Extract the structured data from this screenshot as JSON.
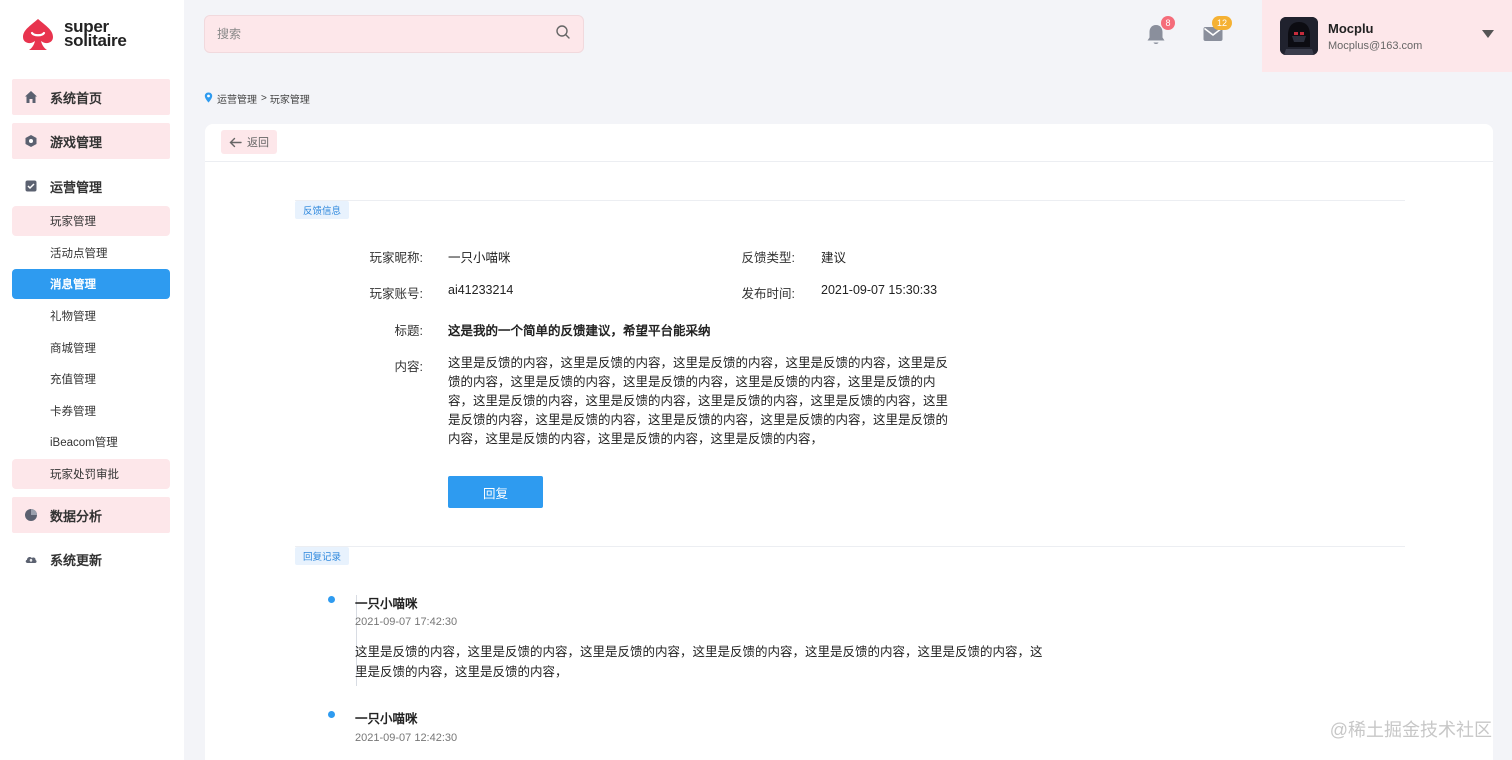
{
  "brand": {
    "line1": "super",
    "line2": "solitaire",
    "color": "#e8344e"
  },
  "sidebar": {
    "items": [
      {
        "label": "系统首页",
        "icon": "home-icon"
      },
      {
        "label": "游戏管理",
        "icon": "game-icon"
      },
      {
        "label": "运营管理",
        "icon": "operations-icon"
      },
      {
        "label": "数据分析",
        "icon": "pie-chart-icon"
      },
      {
        "label": "系统更新",
        "icon": "cloud-upload-icon"
      }
    ],
    "sub_items": [
      {
        "label": "玩家管理"
      },
      {
        "label": "活动点管理"
      },
      {
        "label": "消息管理"
      },
      {
        "label": "礼物管理"
      },
      {
        "label": "商城管理"
      },
      {
        "label": "充值管理"
      },
      {
        "label": "卡券管理"
      },
      {
        "label": "iBeacom管理"
      },
      {
        "label": "玩家处罚审批"
      }
    ],
    "active": "消息管理"
  },
  "search": {
    "placeholder": "搜索",
    "value": ""
  },
  "header": {
    "notifications": {
      "count": "8"
    },
    "messages": {
      "count": "12"
    },
    "user": {
      "name": "Mocplu",
      "email": "Mocplus@163.com"
    }
  },
  "breadcrumb": {
    "items": [
      "运营管理",
      "玩家管理"
    ],
    "separator": ">"
  },
  "card": {
    "back_label": "返回",
    "feedback_section": "反馈信息",
    "reply_section": "回复记录",
    "fields": {
      "nickname_label": "玩家昵称:",
      "nickname": "一只小喵咪",
      "type_label": "反馈类型:",
      "type": "建议",
      "account_label": "玩家账号:",
      "account": "ai41233214",
      "time_label": "发布时间:",
      "time": "2021-09-07 15:30:33",
      "title_label": "标题:",
      "title": "这是我的一个简单的反馈建议，希望平台能采纳",
      "content_label": "内容:",
      "content": "这里是反馈的内容，这里是反馈的内容，这里是反馈的内容，这里是反馈的内容，这里是反馈的内容，这里是反馈的内容，这里是反馈的内容，这里是反馈的内容，这里是反馈的内容，这里是反馈的内容，这里是反馈的内容，这里是反馈的内容，这里是反馈的内容，这里是反馈的内容，这里是反馈的内容，这里是反馈的内容，这里是反馈的内容，这里是反馈的内容，这里是反馈的内容，这里是反馈的内容，这里是反馈的内容，"
    },
    "reply_button": "回复",
    "replies": [
      {
        "name": "一只小喵咪",
        "time": "2021-09-07 17:42:30",
        "body": "这里是反馈的内容，这里是反馈的内容，这里是反馈的内容，这里是反馈的内容，这里是反馈的内容，这里是反馈的内容，这里是反馈的内容，这里是反馈的内容，"
      },
      {
        "name": "一只小喵咪",
        "time": "2021-09-07 12:42:30",
        "body": ""
      }
    ]
  },
  "watermark": "@稀土掘金技术社区",
  "colors": {
    "accent": "#2e9bf0",
    "pink": "#fde7ea",
    "badge_red": "#f56c7a",
    "badge_orange": "#f5b133"
  }
}
